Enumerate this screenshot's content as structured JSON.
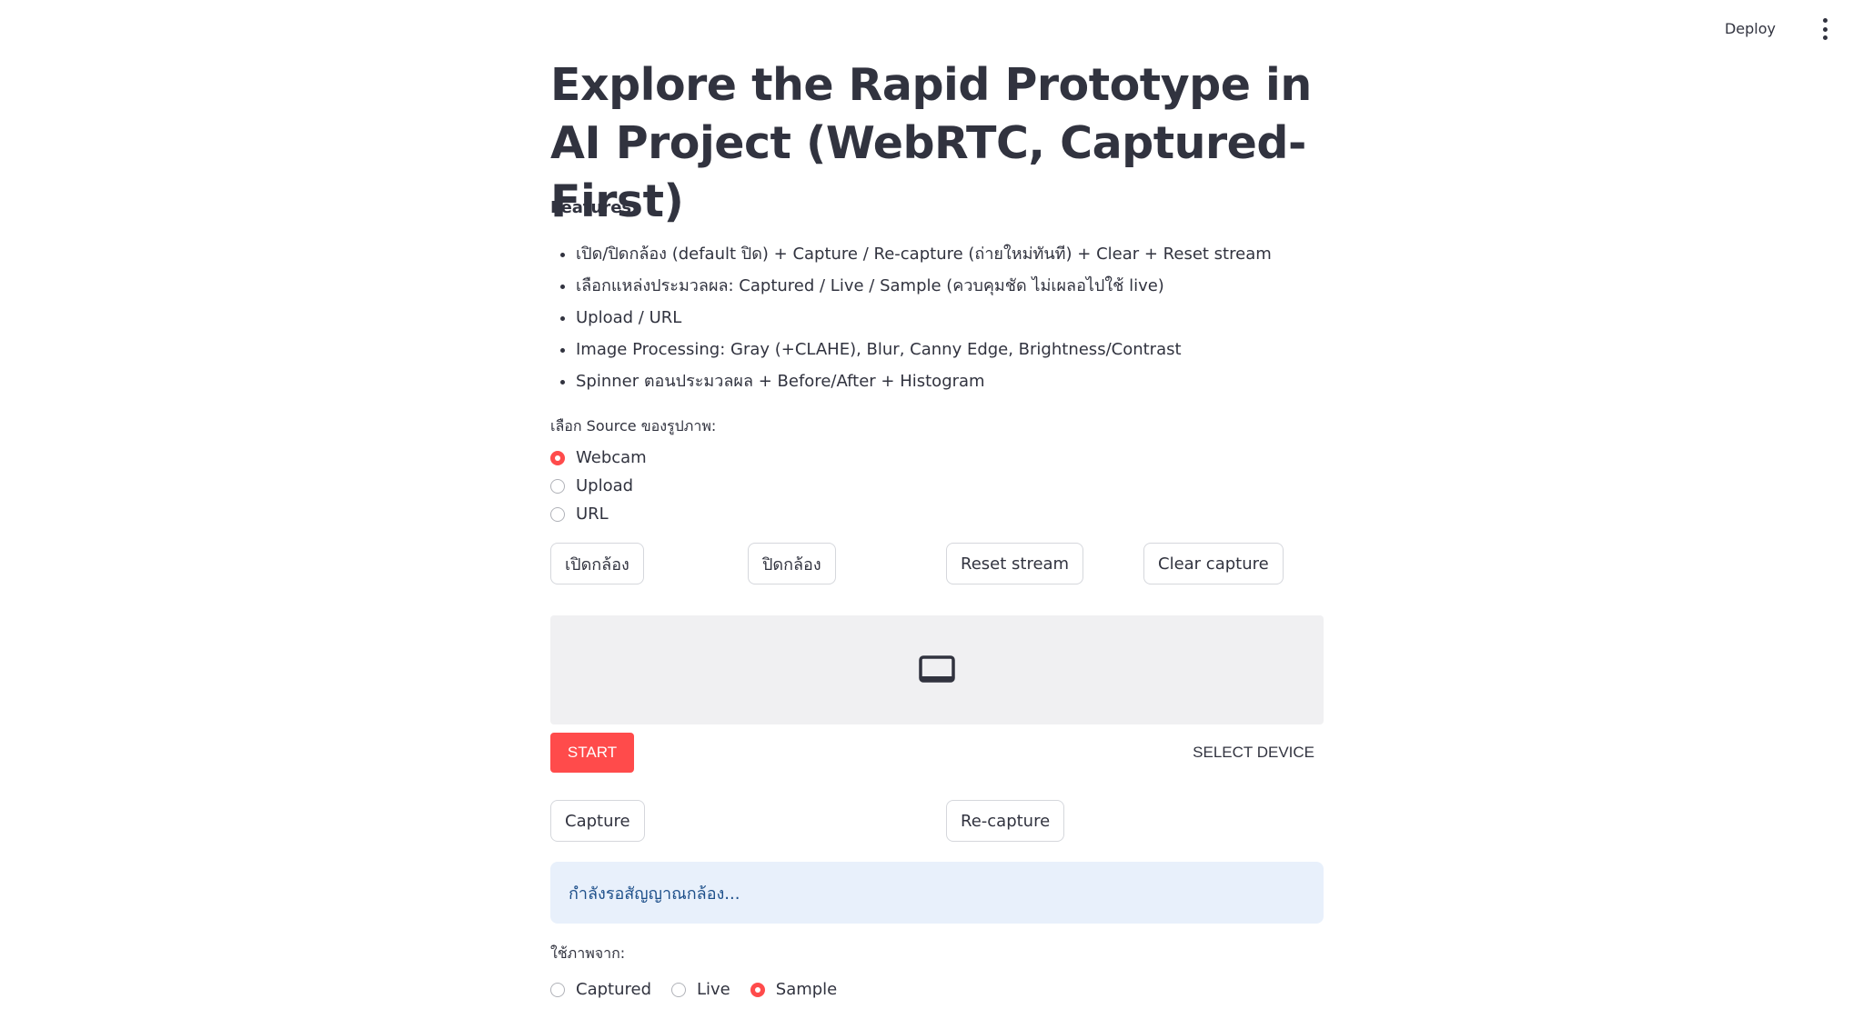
{
  "header": {
    "deploy_label": "Deploy",
    "menu_icon": "more-vertical-icon"
  },
  "title": "Explore the Rapid Prototype in AI Project (WebRTC, Captured-First)",
  "features": {
    "label": "Features",
    "items": [
      "เปิด/ปิดกล้อง (default ปิด) + Capture / Re-capture (ถ่ายใหม่ทันที) + Clear + Reset stream",
      "เลือกแหล่งประมวลผล: Captured / Live / Sample (ควบคุมชัด ไม่เผลอไปใช้ live)",
      "Upload / URL",
      "Image Processing: Gray (+CLAHE), Blur, Canny Edge, Brightness/Contrast",
      "Spinner ตอนประมวลผล + Before/After + Histogram"
    ]
  },
  "source_select": {
    "label": "เลือก Source ของรูปภาพ:",
    "options": [
      "Webcam",
      "Upload",
      "URL"
    ],
    "selected": "Webcam"
  },
  "camera_buttons": {
    "open": "เปิดกล้อง",
    "close": "ปิดกล้อง",
    "reset": "Reset stream",
    "clear": "Clear capture"
  },
  "webrtc": {
    "placeholder_icon": "video-display-icon",
    "start_label": "START",
    "select_device_label": "SELECT DEVICE",
    "start_color": "#ff4b4b"
  },
  "capture_buttons": {
    "capture": "Capture",
    "recapture": "Re-capture"
  },
  "info": {
    "message": "กำลังรอสัญญาณกล้อง..."
  },
  "use_from": {
    "label": "ใช้ภาพจาก:",
    "options": [
      "Captured",
      "Live",
      "Sample"
    ],
    "selected": "Sample"
  },
  "colors": {
    "accent": "#ff4b4b",
    "info_bg": "#e8f0fb",
    "info_text": "#1d4f8a",
    "text": "#31333f"
  }
}
